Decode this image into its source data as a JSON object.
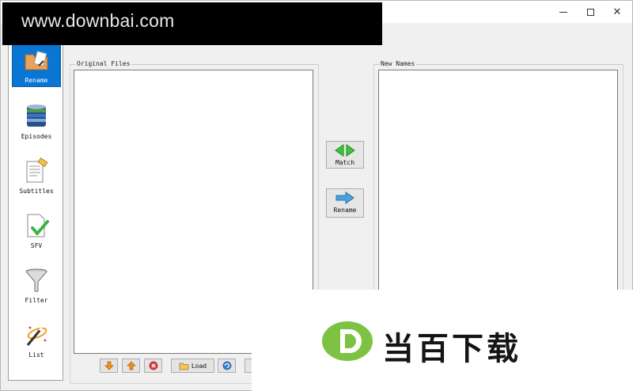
{
  "watermark": {
    "text": "www.downbai.com"
  },
  "window_controls": {
    "minimize": "minimize",
    "maximize": "maximize",
    "close": "✕"
  },
  "sidebar": {
    "items": [
      {
        "label": "Rename",
        "icon": "rename-folder-icon",
        "active": true
      },
      {
        "label": "Episodes",
        "icon": "database-icon",
        "active": false
      },
      {
        "label": "Subtitles",
        "icon": "subtitles-document-icon",
        "active": false
      },
      {
        "label": "SFV",
        "icon": "sfv-checkmark-icon",
        "active": false
      },
      {
        "label": "Filter",
        "icon": "funnel-icon",
        "active": false
      },
      {
        "label": "List",
        "icon": "magic-wand-icon",
        "active": false
      }
    ]
  },
  "panels": {
    "original_files_label": "Original Files",
    "new_names_label": "New Names"
  },
  "actions": {
    "match_label": "Match",
    "rename_label": "Rename"
  },
  "toolbar": {
    "load_label": "Load"
  },
  "logo": {
    "text": "当百下载",
    "letter": "D"
  },
  "colors": {
    "accent": "#0a76d4",
    "window_bg": "#f0f0f0",
    "green_arrow": "#3cc23c",
    "blue_arrow": "#4aa3e0",
    "logo_green": "#7dc242"
  }
}
